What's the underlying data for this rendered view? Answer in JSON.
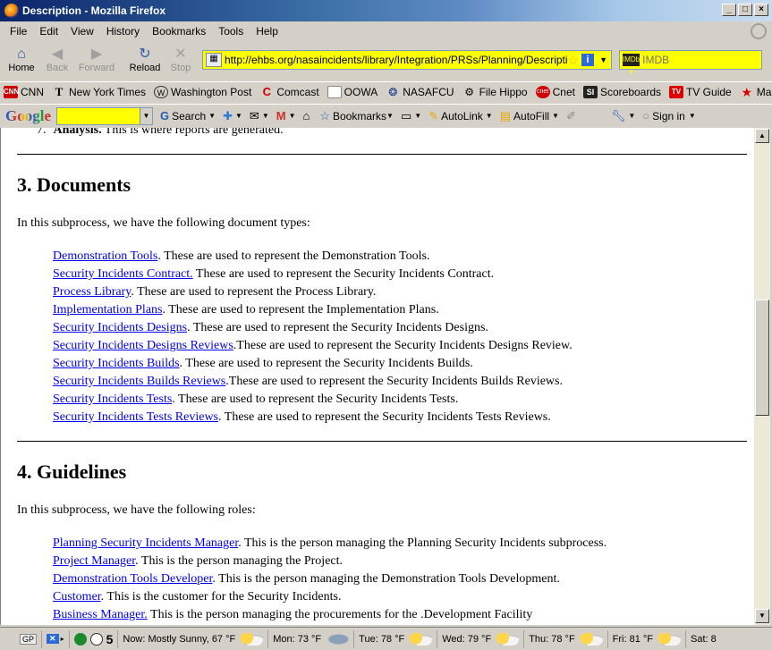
{
  "window": {
    "title": "Description - Mozilla Firefox"
  },
  "menu": [
    "File",
    "Edit",
    "View",
    "History",
    "Bookmarks",
    "Tools",
    "Help"
  ],
  "nav": {
    "home": "Home",
    "back": "Back",
    "forward": "Forward",
    "reload": "Reload",
    "stop": "Stop"
  },
  "url": "http://ehbs.org/nasaincidents/library/Integration/PRSs/Planning/Description.",
  "search": {
    "placeholder": "IMDB"
  },
  "bookmarks": [
    "CNN",
    "New York Times",
    "Washington Post",
    "Comcast",
    "OOWA",
    "NASAFCU",
    "File Hippo",
    "Cnet",
    "Scoreboards",
    "TV Guide",
    "MapQuest"
  ],
  "google_toolbar": {
    "logo": "Google",
    "search": "Search",
    "bookmarks": "Bookmarks",
    "autolink": "AutoLink",
    "autofill": "AutoFill",
    "signin": "Sign in"
  },
  "page": {
    "prev_item_num": "7.",
    "prev_item_bold": "Analysis.",
    "prev_item_text": " This is where reports are generated.",
    "section3": {
      "heading": "3. Documents",
      "intro": "In this subprocess, we have the following document types:",
      "items": [
        {
          "link": "Demonstration Tools",
          "text": ". These are used to represent the Demonstration Tools."
        },
        {
          "link": "Security Incidents Contract.",
          "text": " These are used to represent the Security Incidents Contract."
        },
        {
          "link": "Process Library",
          "text": ". These are used to represent the Process Library."
        },
        {
          "link": "Implementation Plans",
          "text": ". These are used to represent the Implementation Plans."
        },
        {
          "link": "Security Incidents Designs",
          "text": ". These are used to represent the Security Incidents Designs."
        },
        {
          "link": "Security Incidents Designs Reviews",
          "text": ".These are used to represent the Security Incidents Designs Review."
        },
        {
          "link": "Security Incidents Builds",
          "text": ". These are used to represent the Security Incidents Builds."
        },
        {
          "link": "Security Incidents Builds Reviews",
          "text": ".These are used to represent the Security Incidents Builds Reviews."
        },
        {
          "link": "Security Incidents Tests",
          "text": ". These are used to represent the Security Incidents Tests."
        },
        {
          "link": "Security Incidents Tests Reviews",
          "text": ". These are used to represent the Security Incidents Tests Reviews."
        }
      ]
    },
    "section4": {
      "heading": "4. Guidelines",
      "intro": "In this subprocess, we have the following roles:",
      "items": [
        {
          "link": "Planning Security Incidents Manager",
          "text": ". This is the person managing the Planning Security Incidents subprocess."
        },
        {
          "link": "Project Manager",
          "text": ". This is the person managing the Project."
        },
        {
          "link": "Demonstration Tools Developer",
          "text": ". This is the person managing the Demonstration Tools Development."
        },
        {
          "link": "Customer",
          "text": ". This is the customer for the Security Incidents."
        },
        {
          "link": "Business Manager.",
          "text": " This is the person managing the procurements for the .Development Facility"
        }
      ]
    }
  },
  "status": {
    "gp": "GP",
    "five": "5",
    "now": "Now: Mostly Sunny, 67 °F",
    "mon": "Mon: 73 °F",
    "tue": "Tue: 78 °F",
    "wed": "Wed: 79 °F",
    "thu": "Thu: 78 °F",
    "fri": "Fri: 81 °F",
    "sat": "Sat: 8"
  }
}
